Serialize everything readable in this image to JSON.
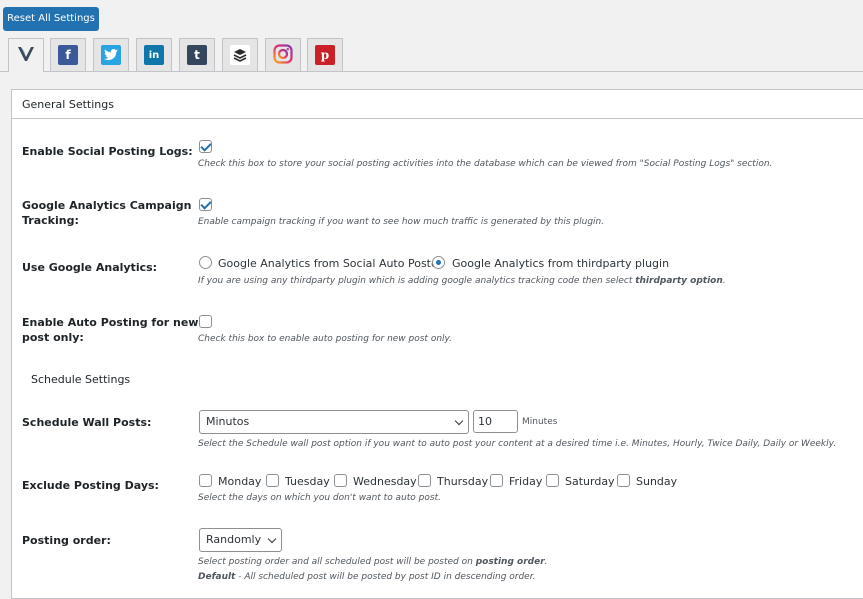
{
  "reset_button": "Reset All Settings",
  "tabs": [
    {
      "name": "social-auto-poster",
      "icon": "check-logo-icon",
      "active": true
    },
    {
      "name": "facebook",
      "icon": "facebook-icon",
      "glyph": "f",
      "color": "#3b5998"
    },
    {
      "name": "twitter",
      "icon": "twitter-icon",
      "glyph": "t",
      "color": "#2aa3e3"
    },
    {
      "name": "linkedin",
      "icon": "linkedin-icon",
      "glyph": "in",
      "color": "#0e76a8"
    },
    {
      "name": "tumblr",
      "icon": "tumblr-icon",
      "glyph": "t",
      "color": "#35465c"
    },
    {
      "name": "buffer",
      "icon": "buffer-icon",
      "glyph": "≡",
      "color": "#2c2c2c"
    },
    {
      "name": "instagram",
      "icon": "instagram-icon",
      "color": "#e1306c"
    },
    {
      "name": "pinterest",
      "icon": "pinterest-icon",
      "glyph": "p",
      "color": "#cb2027"
    }
  ],
  "panel": {
    "title": "General Settings"
  },
  "social_logs": {
    "label": "Enable Social Posting Logs:",
    "checked": true,
    "desc": "Check this box to store your social posting activities into the database which can be viewed from \"Social Posting Logs\" section."
  },
  "ga_campaign": {
    "label_line1": "Google Analytics Campaign",
    "label_line2": "Tracking:",
    "checked": true,
    "desc": "Enable campaign tracking if you want to see how much traffic is generated by this plugin."
  },
  "use_ga": {
    "label": "Use Google Analytics:",
    "options": [
      "Google Analytics from Social Auto Poster",
      "Google Analytics from thirdparty plugin"
    ],
    "selected": 1,
    "desc_pre": "If you are using any thirdparty plugin which is adding google analytics tracking code then select ",
    "desc_bold": "thirdparty option",
    "desc_post": "."
  },
  "auto_post_new": {
    "label_line1": "Enable Auto Posting for new",
    "label_line2": "post only:",
    "checked": false,
    "desc": "Check this box to enable auto posting for new post only."
  },
  "schedule_section": "Schedule Settings",
  "schedule_wall": {
    "label": "Schedule Wall Posts:",
    "select_value": "Minutos",
    "input_value": "10",
    "unit": "Minutes",
    "desc": "Select the Schedule wall post option if you want to auto post your content at a desired time i.e. Minutes, Hourly, Twice Daily, Daily or Weekly."
  },
  "exclude_days": {
    "label": "Exclude Posting Days:",
    "days": [
      "Monday",
      "Tuesday",
      "Wednesday",
      "Thursday",
      "Friday",
      "Saturday",
      "Sunday"
    ],
    "desc": "Select the days on which you don't want to auto post."
  },
  "posting_order": {
    "label": "Posting order:",
    "select_value": "Randomly",
    "desc1_pre": "Select posting order and all scheduled post will be posted on ",
    "desc1_bold": "posting order",
    "desc1_post": ".",
    "desc2_bold": "Default",
    "desc2_rest": " - All scheduled post will be posted by post ID in descending order."
  }
}
